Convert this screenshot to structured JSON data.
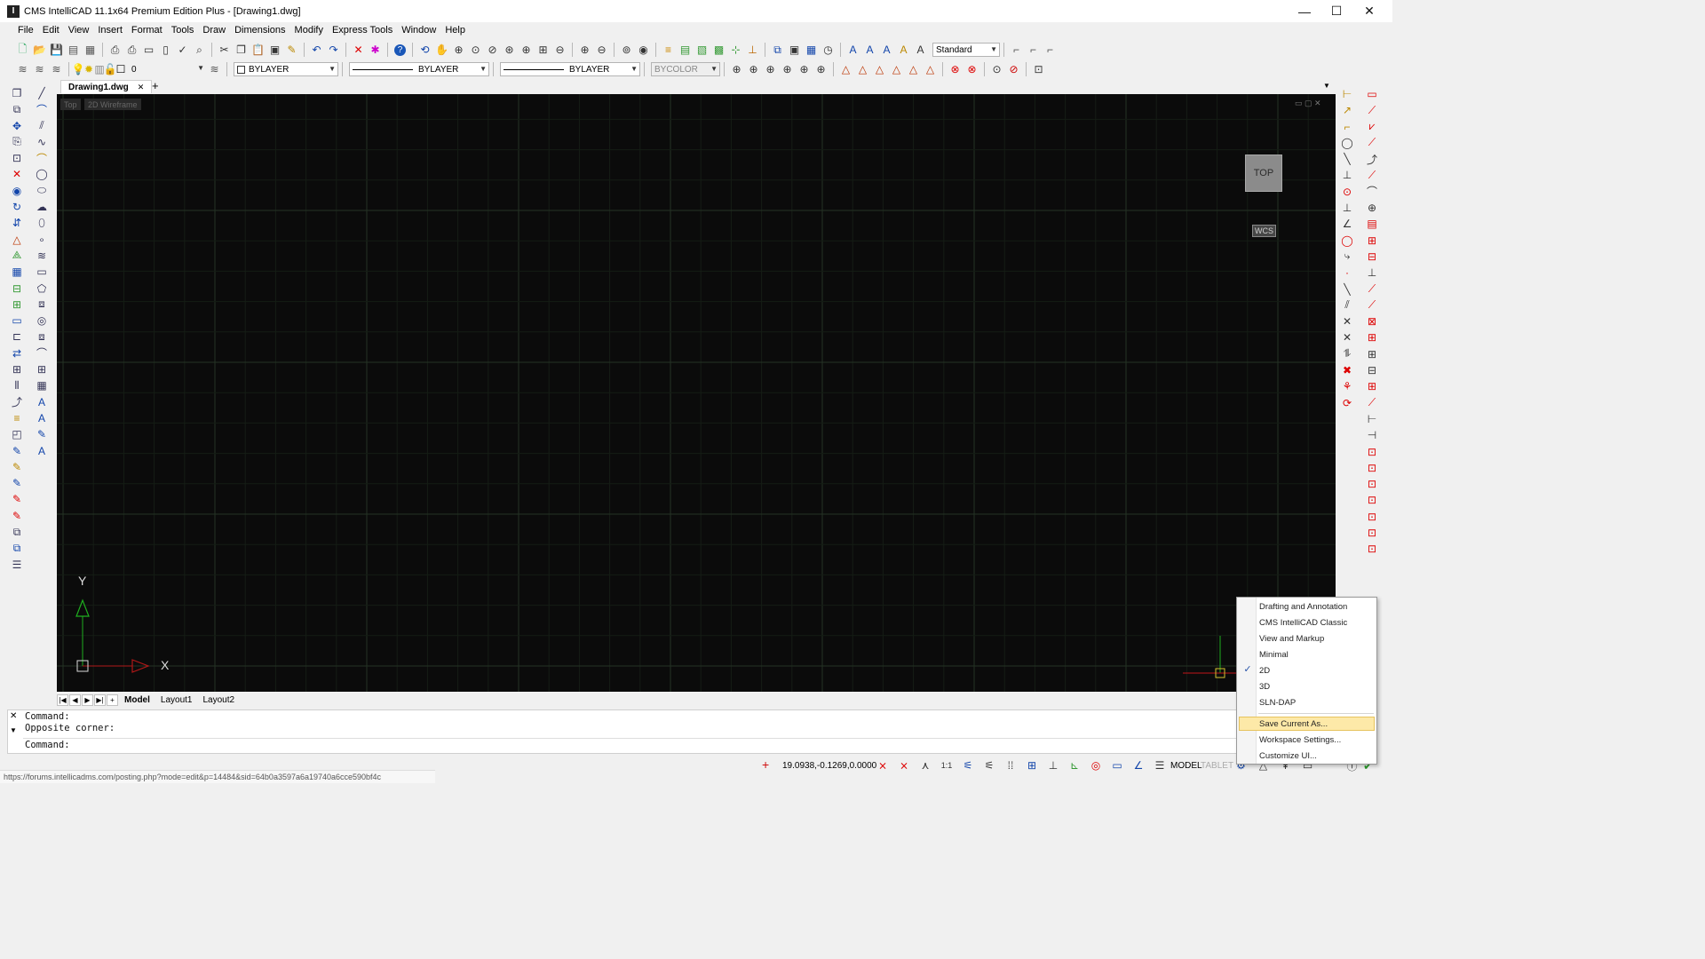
{
  "window": {
    "title": "CMS IntelliCAD 11.1x64 Premium Edition Plus  - [Drawing1.dwg]",
    "app_icon": "cad-app-icon",
    "minimize": "—",
    "maximize": "☐",
    "close": "✕"
  },
  "menu": [
    "File",
    "Edit",
    "View",
    "Insert",
    "Format",
    "Tools",
    "Draw",
    "Dimensions",
    "Modify",
    "Express Tools",
    "Window",
    "Help"
  ],
  "toolbar": {
    "text_style": "Standard",
    "layer": "0",
    "color": "BYLAYER",
    "linetype": "BYLAYER",
    "lineweight": "BYLAYER",
    "plot_style": "BYCOLOR"
  },
  "document": {
    "tab": "Drawing1.dwg",
    "close": "✕",
    "new_tab": "+",
    "view_name": "Top",
    "visual_style": "2D Wireframe",
    "view_cube": "TOP",
    "wcs": "WCS",
    "axis_x": "X",
    "axis_y": "Y"
  },
  "layout_tabs": [
    "Model",
    "Layout1",
    "Layout2"
  ],
  "command": {
    "line1": "Command:",
    "line2": "Opposite corner:",
    "prompt": "Command:"
  },
  "status": {
    "coords": "19.0938,-0.1269,0.0000",
    "scale": "1:1",
    "space": "MODEL",
    "tablet": "TABLET"
  },
  "url": "https://forums.intellicadms.com/posting.php?mode=edit&p=14484&sid=64b0a3597a6a19740a6cce590bf4c",
  "workspace_menu": {
    "items": [
      "Drafting and Annotation",
      "CMS IntelliCAD Classic",
      "View and Markup",
      "Minimal",
      "2D",
      "3D",
      "SLN-DAP"
    ],
    "checked": "2D",
    "actions": [
      "Save Current As...",
      "Workspace Settings...",
      "Customize UI..."
    ],
    "highlighted": "Save Current As..."
  },
  "colors": {
    "canvas": "#0b0b0b",
    "grid": "#1c2a1c",
    "x_axis": "#b01818",
    "y_axis": "#1fae1f",
    "accent": "#d8003a"
  }
}
